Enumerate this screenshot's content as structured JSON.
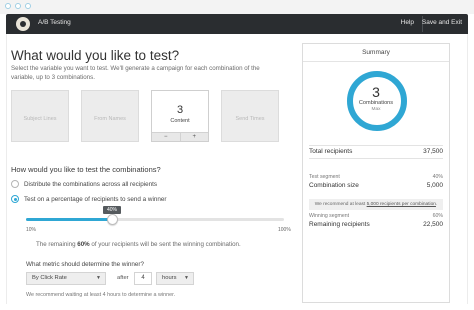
{
  "app": {
    "title": "A/B Testing",
    "help": "Help",
    "save_exit": "Save and Exit"
  },
  "page": {
    "heading": "What would you like to test?",
    "intro": "Select the variable you want to test. We'll generate a campaign for each combination of the variable, up to 3 combinations."
  },
  "variables": [
    {
      "label": "Subject Lines",
      "selected": false
    },
    {
      "label": "From Names",
      "selected": false
    },
    {
      "label": "Content",
      "selected": true,
      "count": "3"
    },
    {
      "label": "Send Times",
      "selected": false
    }
  ],
  "stepper": {
    "minus": "−",
    "plus": "+"
  },
  "test_method": {
    "question": "How would you like to test the combinations?",
    "options": [
      "Distribute the combinations across all recipients",
      "Test on a percentage of recipients to send a winner"
    ],
    "selected_index": 1
  },
  "slider": {
    "value_pct": 40,
    "value_label": "40%",
    "min_label": "10%",
    "max_label": "100%",
    "min": 10,
    "max": 100
  },
  "remaining": {
    "prefix": "The remaining",
    "pct": "60%",
    "suffix": "of your recipients will be sent the winning combination."
  },
  "metric": {
    "question": "What metric should determine the winner?",
    "selected": "By Click Rate",
    "after_label": "after",
    "amount": "4",
    "unit": "hours",
    "recommendation": "We recommend waiting at least 4 hours to determine a winner."
  },
  "summary": {
    "title": "Summary",
    "combinations": "3",
    "combinations_label": "Combinations",
    "combinations_sub": "Max",
    "total_recipients_label": "Total recipients",
    "total_recipients": "37,500",
    "test_segment_label": "Test segment",
    "test_segment": "40%",
    "combination_size_label": "Combination size",
    "combination_size": "5,000",
    "note_prefix": "We recommend at least",
    "note_link": "5,000 recipients per combination",
    "note_suffix": ".",
    "winning_segment_label": "Winning segment",
    "winning_segment": "60%",
    "remaining_recipients_label": "Remaining recipients",
    "remaining_recipients": "22,500"
  },
  "colors": {
    "accent": "#2fa7d4",
    "header_bg": "#2a2d30"
  }
}
